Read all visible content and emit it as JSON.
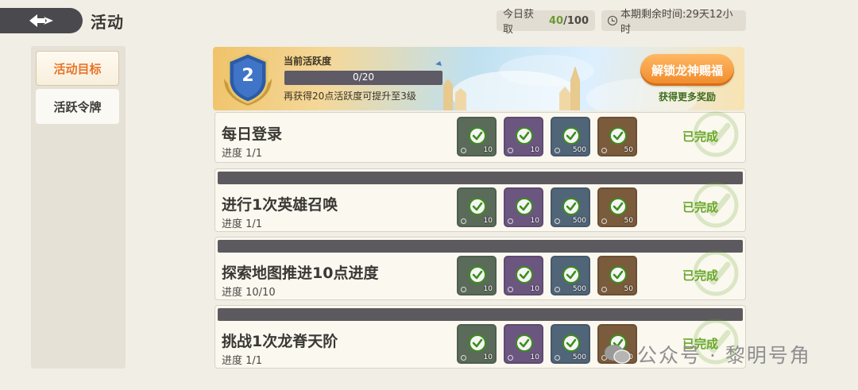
{
  "header": {
    "title": "活动",
    "today_label": "今日获取",
    "today_value": "40",
    "today_total": "/100",
    "remaining_label": "本期剩余时间:29天12小时"
  },
  "tabs": [
    {
      "label": "活动目标",
      "active": true
    },
    {
      "label": "活跃令牌",
      "active": false
    }
  ],
  "banner": {
    "level": "2",
    "activity_label": "当前活跃度",
    "progress_text": "0/20",
    "progress_fraction": 0,
    "hint": "再获得20点活跃度可提升至3级",
    "unlock_button": "解锁龙神赐福",
    "unlock_sub": "获得更多奖励"
  },
  "rewards": [
    {
      "qty": "10",
      "color": "#5b6b5a"
    },
    {
      "qty": "10",
      "color": "#6b5680"
    },
    {
      "qty": "500",
      "color": "#516578"
    },
    {
      "qty": "50",
      "color": "#7a5b3c"
    }
  ],
  "tasks": [
    {
      "title": "每日登录",
      "progress": "进度 1/1",
      "status": "已完成"
    },
    {
      "title": "进行1次英雄召唤",
      "progress": "进度 1/1",
      "status": "已完成"
    },
    {
      "title": "探索地图推进10点进度",
      "progress": "进度 10/10",
      "status": "已完成"
    },
    {
      "title": "挑战1次龙脊天阶",
      "progress": "进度 1/1",
      "status": "已完成"
    }
  ],
  "watermark": "公众号 · 黎明号角",
  "colors": {
    "accent_orange": "#f08a2a",
    "complete_green": "#6aa82b",
    "check_green": "#3c8d1c"
  }
}
